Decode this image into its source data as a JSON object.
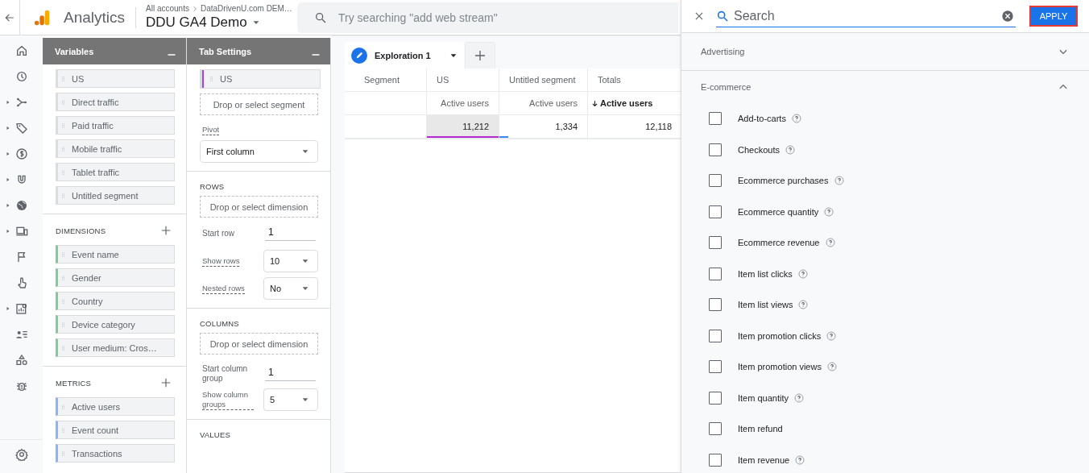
{
  "topbar": {
    "product": "Analytics",
    "breadcrumb": "All accounts",
    "account": "DataDrivenU.com DEM…",
    "property": "DDU GA4 Demo",
    "search": {
      "placeholder": "Try searching \"add web stream\""
    }
  },
  "nav_rail": [
    {
      "expandable": false
    },
    {
      "expandable": false
    },
    {
      "expandable": true
    },
    {
      "expandable": true
    },
    {
      "expandable": true
    },
    {
      "expandable": true
    },
    {
      "expandable": true
    },
    {
      "expandable": true
    },
    {
      "expandable": false
    },
    {
      "expandable": false
    },
    {
      "expandable": true
    },
    {
      "expandable": false
    },
    {
      "expandable": false
    },
    {
      "expandable": false
    }
  ],
  "variables": {
    "title": "Variables",
    "segments": [
      "US",
      "Direct traffic",
      "Paid traffic",
      "Mobile traffic",
      "Tablet traffic",
      "Untitled segment"
    ],
    "dimensions": {
      "heading": "DIMENSIONS",
      "items": [
        "Event name",
        "Gender",
        "Country",
        "Device category",
        "User medium: Cros…"
      ]
    },
    "metrics": {
      "heading": "METRICS",
      "items": [
        "Active users",
        "Event count",
        "Transactions"
      ]
    }
  },
  "tab_settings": {
    "title": "Tab Settings",
    "segments": [
      {
        "label": "US",
        "color": "#a142f4"
      }
    ],
    "segment_drop": "Drop or select segment",
    "pivot": {
      "label": "Pivot",
      "value": "First column"
    },
    "rows": {
      "heading": "ROWS",
      "drop": "Drop or select dimension",
      "start_label": "Start row",
      "start_value": "1",
      "show_label": "Show rows",
      "show_value": "10",
      "nested_label": "Nested rows",
      "nested_value": "No"
    },
    "columns": {
      "heading": "COLUMNS",
      "drop": "Drop or select dimension",
      "start_label": "Start column group",
      "start_value": "1",
      "show_label": "Show column groups",
      "show_value": "5"
    },
    "values": {
      "heading": "VALUES"
    }
  },
  "exploration": {
    "tabs": [
      {
        "label": "Exploration 1",
        "selected": true
      }
    ],
    "table": {
      "row_header": "Segment",
      "columns": [
        {
          "label": "US",
          "metric": "Active users",
          "sorted": false,
          "color": "#b52ad0"
        },
        {
          "label": "Untitled segment",
          "metric": "Active users",
          "sorted": false,
          "color": "#4285f4"
        },
        {
          "label": "Totals",
          "metric": "Active users",
          "sorted": true
        }
      ],
      "rows": [
        {
          "cells": [
            "11,212",
            "1,334",
            "12,118"
          ]
        }
      ]
    }
  },
  "picker": {
    "search": {
      "placeholder": "Search"
    },
    "apply": "APPLY",
    "groups": [
      {
        "label": "Advertising",
        "expanded": false
      },
      {
        "label": "E-commerce",
        "expanded": true,
        "items": [
          {
            "label": "Add-to-carts",
            "checked": false,
            "help": true
          },
          {
            "label": "Checkouts",
            "checked": false,
            "help": true
          },
          {
            "label": "Ecommerce purchases",
            "checked": false,
            "help": true
          },
          {
            "label": "Ecommerce quantity",
            "checked": false,
            "help": true
          },
          {
            "label": "Ecommerce revenue",
            "checked": false,
            "help": true
          },
          {
            "label": "Item list clicks",
            "checked": false,
            "help": true
          },
          {
            "label": "Item list views",
            "checked": false,
            "help": true
          },
          {
            "label": "Item promotion clicks",
            "checked": false,
            "help": true
          },
          {
            "label": "Item promotion views",
            "checked": false,
            "help": true
          },
          {
            "label": "Item quantity",
            "checked": false,
            "help": true
          },
          {
            "label": "Item refund",
            "checked": false,
            "help": false
          },
          {
            "label": "Item revenue",
            "checked": false,
            "help": true
          }
        ]
      }
    ]
  }
}
